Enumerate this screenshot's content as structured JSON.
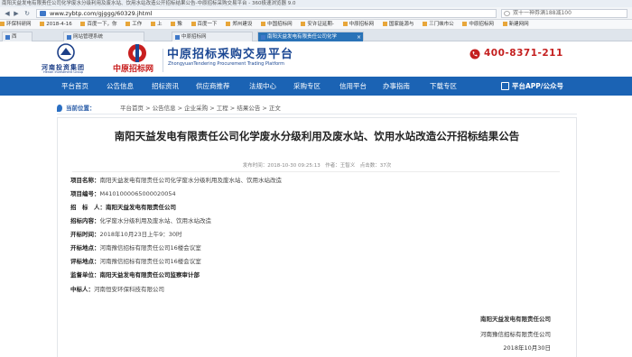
{
  "browser": {
    "window_title": "南阳天益发电有限责任公司化学废水分级利用及废水站、饮用水站改造公开招标结果公告-中原招标采购交易平台 - 360极速浏览器 9.0",
    "url": "www.zybtp.com/gjggg/60329.jhtml",
    "search_placeholder": "双十一神券满188减100",
    "favorites": [
      "环保科研网",
      "2018-4-16",
      "百度一下，你",
      "工作",
      "上",
      "豫",
      "百度一下",
      "郑州建设",
      "",
      "",
      "中国招标网",
      "",
      "安许证延期-",
      "中原招标网",
      "国家能源与",
      "三门峡市公",
      "中原招标网",
      "新建网网"
    ],
    "tabs": [
      {
        "label": "西",
        "active": false
      },
      {
        "label": "网站管理系统",
        "active": false
      },
      {
        "label": "中原招标网",
        "active": false
      },
      {
        "label": "南阳天益发电有限责任公司化学",
        "active": true
      }
    ]
  },
  "header": {
    "group_name": "河南投资集团",
    "group_name_en": "Henan Investment Group",
    "site_name": "中原招标网",
    "platform_cn": "中原招标采购交易平台",
    "platform_en": "ZhongyuanTendering Procurement Trading Platform",
    "hotline": "400-8371-211",
    "colors": {
      "primary": "#1b63b4",
      "accent": "#c41f1f"
    }
  },
  "nav": {
    "items": [
      "平台首页",
      "公告信息",
      "招标资讯",
      "供应商推荐",
      "法规中心",
      "采购专区",
      "信用平台",
      "办事指南",
      "下载专区"
    ],
    "app_link": "平台APP/公众号"
  },
  "breadcrumb": {
    "label": "当前位置：",
    "path": "平台首页 > 公告信息 > 企业采购 > 工程 > 结果公告 > 正文"
  },
  "announcement": {
    "title": "南阳天益发电有限责任公司化学废水分级利用及废水站、饮用水站改造公开招标结果公告",
    "meta": "发布时间：2018-10-30 09:25:13　作者：王智义　点击数：37次",
    "fields": [
      {
        "k": "项目名称：",
        "v": "南阳天益发电有限责任公司化学废水分级利用及废水站、饮用水站改造"
      },
      {
        "k": "项目编号：",
        "v": "M4101000065000020054"
      },
      {
        "k": "招　标　人：",
        "v": "南阳天益发电有限责任公司"
      },
      {
        "k": "招标内容：",
        "v": "化学废水分级利用及废水站、饮用水站改造"
      },
      {
        "k": "开标时间：",
        "v": "2018年10月23日上午9：30时"
      },
      {
        "k": "开标地点：",
        "v": "河南豫信招标有限责任公司16楼会议室"
      },
      {
        "k": "评标地点：",
        "v": "河南豫信招标有限责任公司16楼会议室"
      },
      {
        "k": "监督单位：",
        "v": "南阳天益发电有限责任公司监察审计部"
      },
      {
        "k": "中标人：",
        "v": "河南恒安环保科技有限公司"
      }
    ],
    "signature": {
      "org1": "南阳天益发电有限责任公司",
      "org2": "河南豫信招标有限责任公司",
      "date": "2018年10月30日"
    }
  }
}
